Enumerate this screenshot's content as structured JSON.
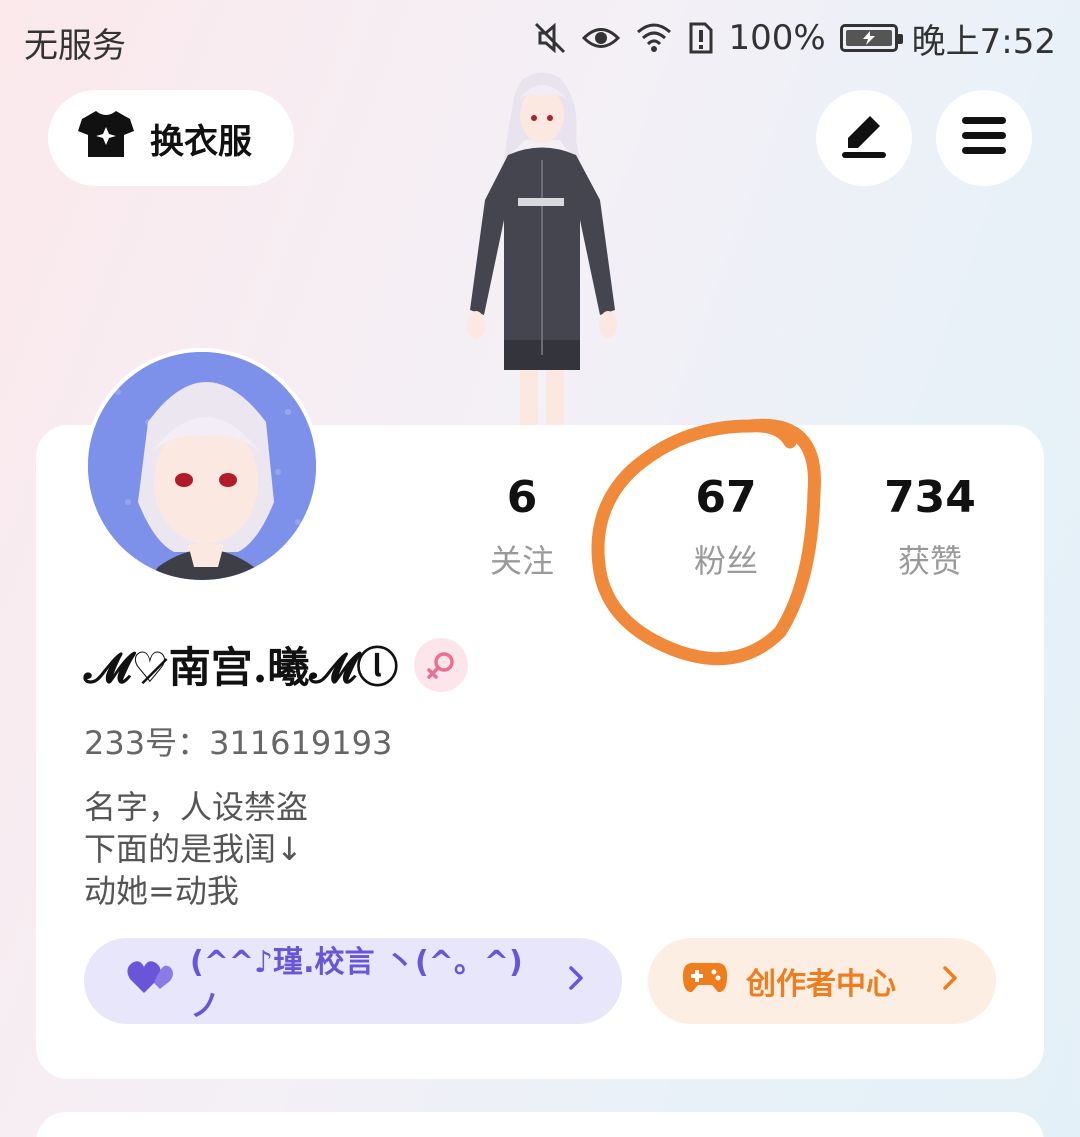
{
  "status_bar": {
    "carrier": "无服务",
    "battery_percent": "100%",
    "time": "晚上7:52"
  },
  "header": {
    "dress_button_label": "换衣服"
  },
  "stats": [
    {
      "value": "6",
      "label": "关注"
    },
    {
      "value": "67",
      "label": "粉丝"
    },
    {
      "value": "734",
      "label": "获赞"
    }
  ],
  "profile": {
    "nickname": "𝓜♡̷南宫.曦𝓜ⓛ",
    "user_id": "233号：311619193",
    "bio": [
      "名字，人设禁盗",
      "下面的是我闺↓",
      "动她=动我"
    ]
  },
  "pills": {
    "tag_label": "(^^♪瑾.校言 丶(^。^)ノ",
    "creator_label": "创作者中心"
  },
  "colors": {
    "tag_purple": "#6a55d8",
    "creator_orange": "#f07d1d",
    "circle_annotation": "#f08a3a"
  }
}
